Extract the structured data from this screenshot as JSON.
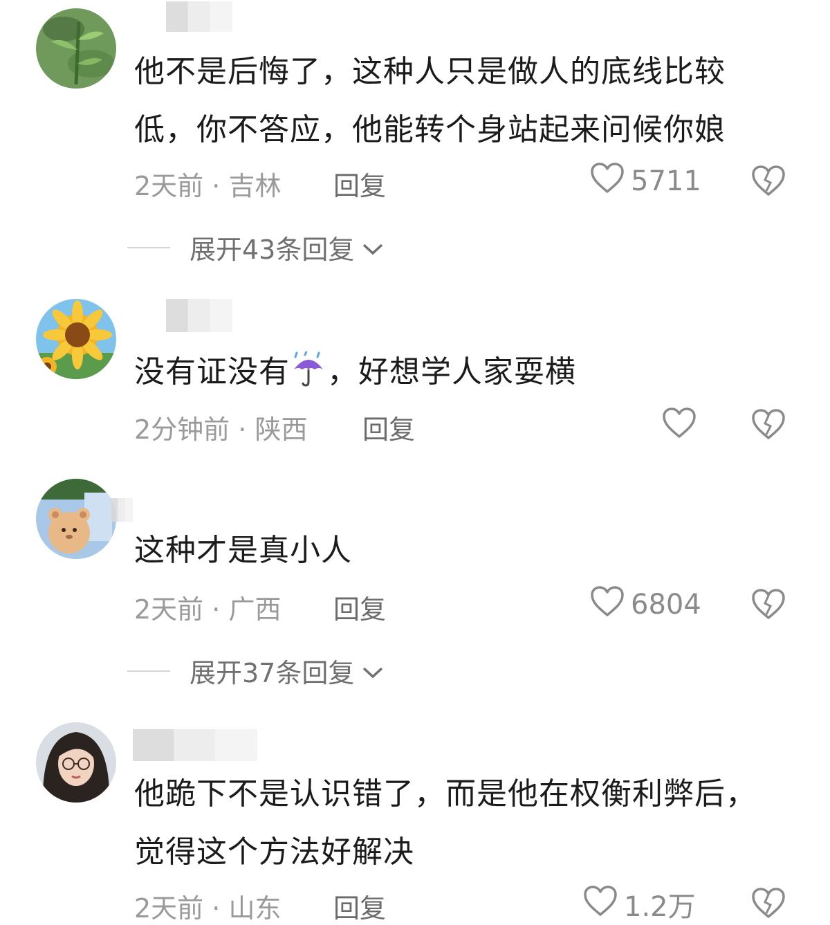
{
  "comments": [
    {
      "body_lines": [
        "他不是后悔了，这种人只是做人的底线比较",
        "低，你不答应，他能转个身站起来问候你娘"
      ],
      "time": "2天前",
      "location": "吉林",
      "reply_label": "回复",
      "likes": "5711",
      "expand_label": "展开43条回复"
    },
    {
      "body_before_emoji": "没有证没有",
      "emoji_name": "umbrella-rain-icon",
      "body_after_emoji": "，好想学人家耍横",
      "time": "2分钟前",
      "location": "陕西",
      "reply_label": "回复"
    },
    {
      "body_lines": [
        "这种才是真小人"
      ],
      "time": "2天前",
      "location": "广西",
      "reply_label": "回复",
      "likes": "6804",
      "expand_label": "展开37条回复"
    },
    {
      "body_lines": [
        "他跪下不是认识错了，而是他在权衡利弊后，",
        "觉得这个方法好解决"
      ],
      "time": "2天前",
      "location": "山东",
      "reply_label": "回复",
      "likes": "1.2万"
    }
  ],
  "separator": " · ",
  "icons": {
    "like": "heart-outline-icon",
    "dislike": "broken-heart-icon",
    "expand": "chevron-down-icon"
  },
  "colors": {
    "text": "#1b1b1b",
    "meta": "#9a9a9a",
    "icon": "#8a8a8a"
  }
}
